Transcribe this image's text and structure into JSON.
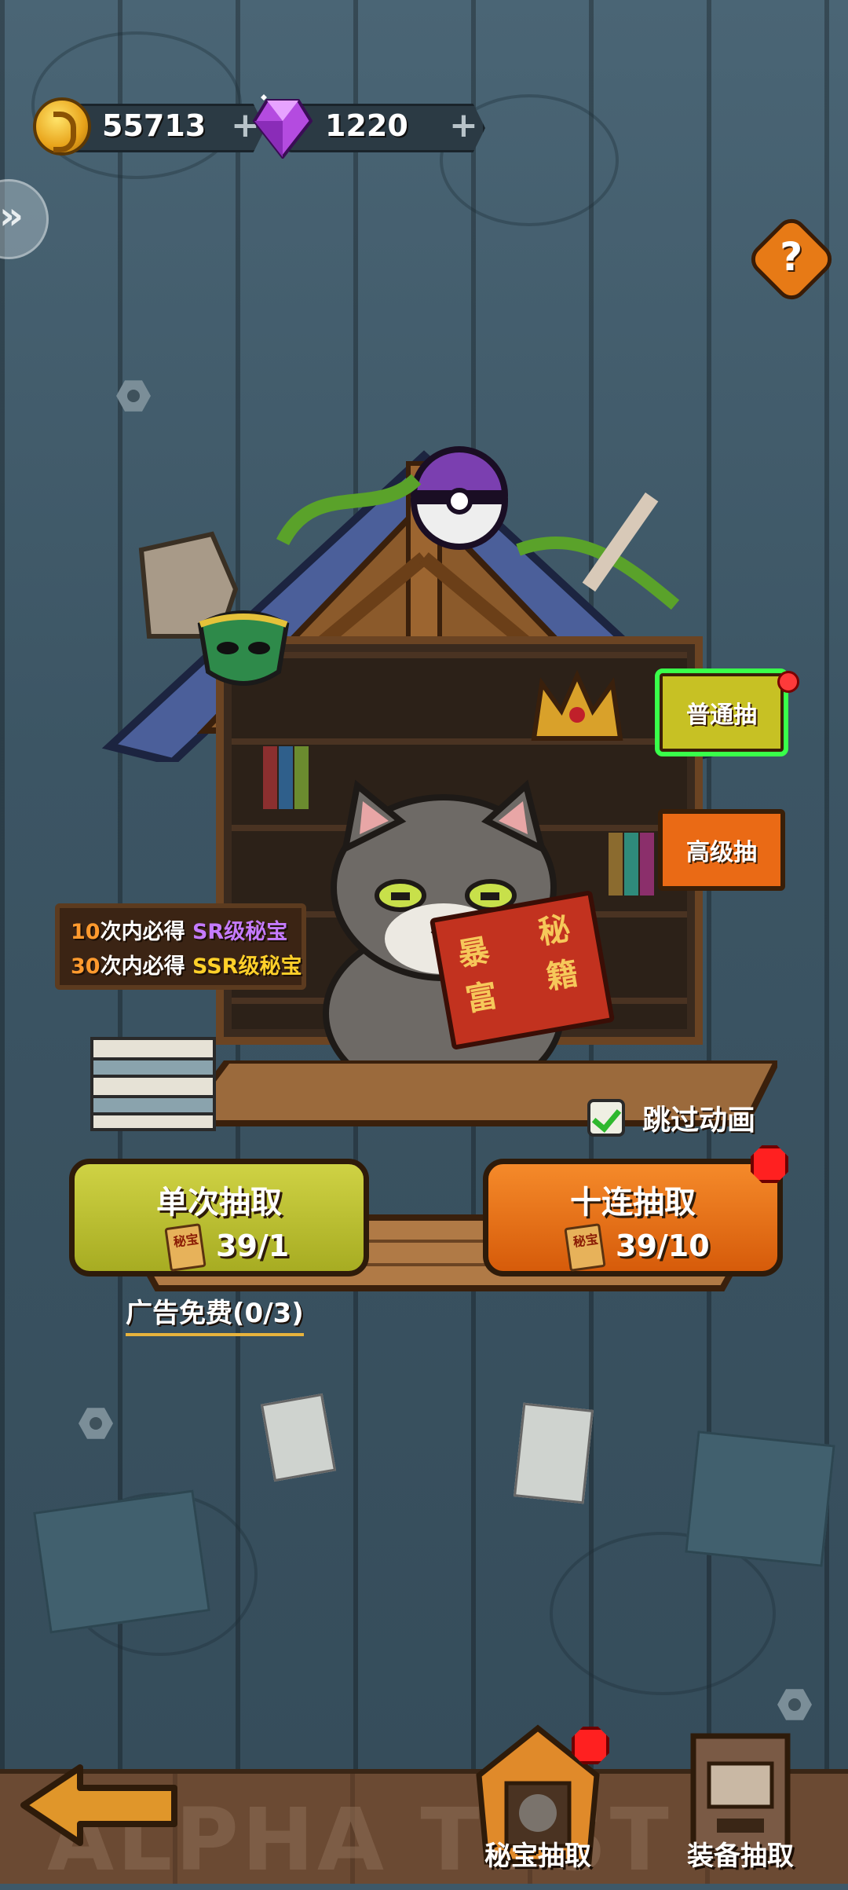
{
  "currency": {
    "coins": "55713",
    "gems": "1220",
    "coin_icon": "gold-coin-icon",
    "gem_icon": "purple-gem-icon"
  },
  "side_tabs": {
    "normal": "普通抽",
    "advanced": "高级抽"
  },
  "guarantee": {
    "line1_count": "10",
    "line1_text": "次内必得",
    "line1_rank": "SR级秘宝",
    "line2_count": "30",
    "line2_text": "次内必得",
    "line2_rank": "SSR级秘宝"
  },
  "book": {
    "left": "暴富",
    "right": "秘籍"
  },
  "skip_animation": {
    "label": "跳过动画",
    "checked": true
  },
  "draw_single": {
    "title": "单次抽取",
    "ticket": "秘宝",
    "count": "39/1"
  },
  "draw_ten": {
    "title": "十连抽取",
    "ticket": "秘宝",
    "count": "39/10"
  },
  "ad_free": "广告免费(0/3)",
  "bottom_nav": {
    "watermark": "ALPHA TEST",
    "tabs": [
      {
        "label": "秘宝抽取"
      },
      {
        "label": "装备抽取"
      }
    ]
  },
  "colors": {
    "accent_green": "#39ff4a",
    "badge_red": "#ff2020",
    "orange": "#ea6a15",
    "yellow_green": "#c7c124"
  }
}
